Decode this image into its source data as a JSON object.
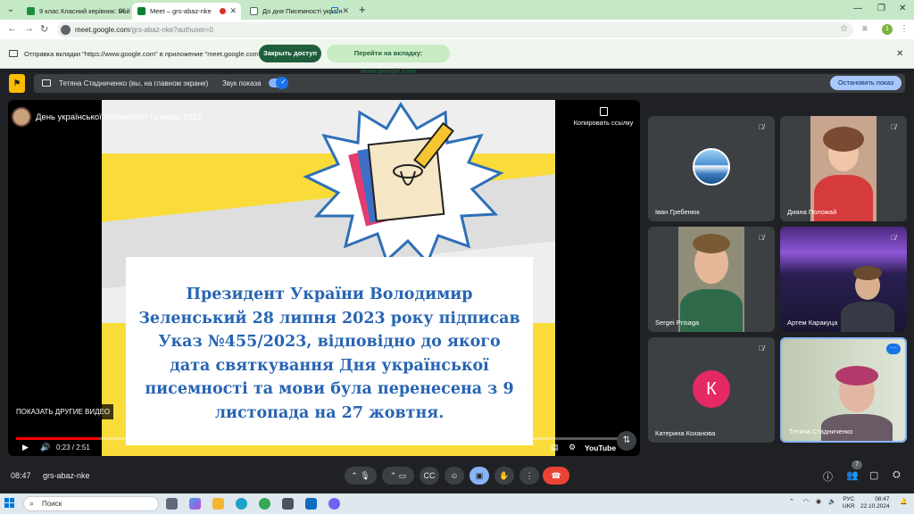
{
  "browser": {
    "tabs": [
      {
        "label": "9 клас Класний керівник: Бойко",
        "favicon_color": "#1e8e3e"
      },
      {
        "label": "Meet – grs-abaz-nke",
        "favicon_color": "#00832d"
      },
      {
        "label": "До дня Писемності україн",
        "favicon_color": "#5f6368"
      }
    ],
    "url_main": "meet.google.com",
    "url_rest": "/grs-abaz-nke?authuser=0",
    "profile_initial": "1"
  },
  "share_bar": {
    "text": "Отправка вкладки \"https://www.google.com\" в приложение \"meet.google.com\"...",
    "stop_label": "Закрыть доступ",
    "switch_label": "Перейти на вкладку: www.google.com"
  },
  "presenter_bar": {
    "name": "Тетяна Стадниченко (вы, на главном экране)",
    "sound_label": "Звук показа",
    "stop_label": "Остановить показ"
  },
  "video": {
    "title": "День української писемності та мови 2023",
    "copy_link": "Копировать ссылку",
    "more_videos": "ПОКАЗАТЬ ДРУГИЕ ВИДЕО",
    "time": "0:23 / 2:51",
    "progress": 0.135,
    "brand": "YouTube",
    "slide_text": "Президент України Володимир Зеленський 28 липня 2023 року підписав Указ №455/2023, відповідно до якого дата святкування Дня української писемності та мови була перенесена з 9 листопада на 27 жовтня."
  },
  "participants": [
    {
      "name": "Іван Гребенюк",
      "type": "avatar-image"
    },
    {
      "name": "Диана Положай",
      "type": "camera"
    },
    {
      "name": "Sergei Prisaga",
      "type": "camera"
    },
    {
      "name": "Артем Каракуца",
      "type": "camera"
    },
    {
      "name": "Катерина Коханова",
      "type": "letter",
      "letter": "К",
      "color": "#e52965"
    },
    {
      "name": "Тетяна Стадниченко",
      "type": "camera"
    }
  ],
  "meet_bar": {
    "clock": "08:47",
    "meeting_code": "grs-abaz-nke",
    "participants_count": "7"
  },
  "taskbar": {
    "search": "Поиск",
    "lang_top": "РУС",
    "lang_bottom": "UKR",
    "time": "08:47",
    "date": "22.10.2024"
  }
}
